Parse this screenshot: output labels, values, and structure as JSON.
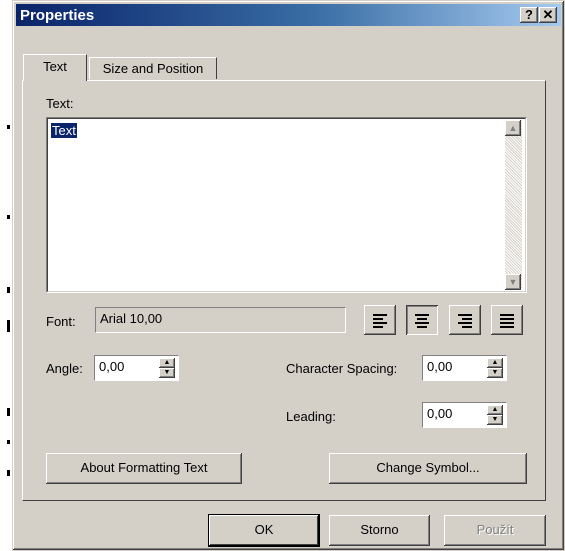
{
  "window": {
    "title": "Properties",
    "help_label": "?",
    "close_label": "✕"
  },
  "tabs": [
    {
      "label": "Text"
    },
    {
      "label": "Size and Position"
    }
  ],
  "text_section": {
    "label": "Text:",
    "value": "Text"
  },
  "font": {
    "label": "Font:",
    "value": "Arial 10,00"
  },
  "alignment": [
    "left",
    "center",
    "right",
    "justify"
  ],
  "angle": {
    "label": "Angle:",
    "value": "0,00"
  },
  "char_spacing": {
    "label": "Character Spacing:",
    "value": "0,00"
  },
  "leading": {
    "label": "Leading:",
    "value": "0,00"
  },
  "buttons": {
    "about": "About Formatting Text",
    "change_symbol": "Change Symbol...",
    "ok": "OK",
    "cancel": "Storno",
    "apply": "Použít"
  },
  "icons": {
    "scroll_up": "▲",
    "scroll_down": "▼",
    "spin_up": "▲",
    "spin_down": "▼"
  }
}
